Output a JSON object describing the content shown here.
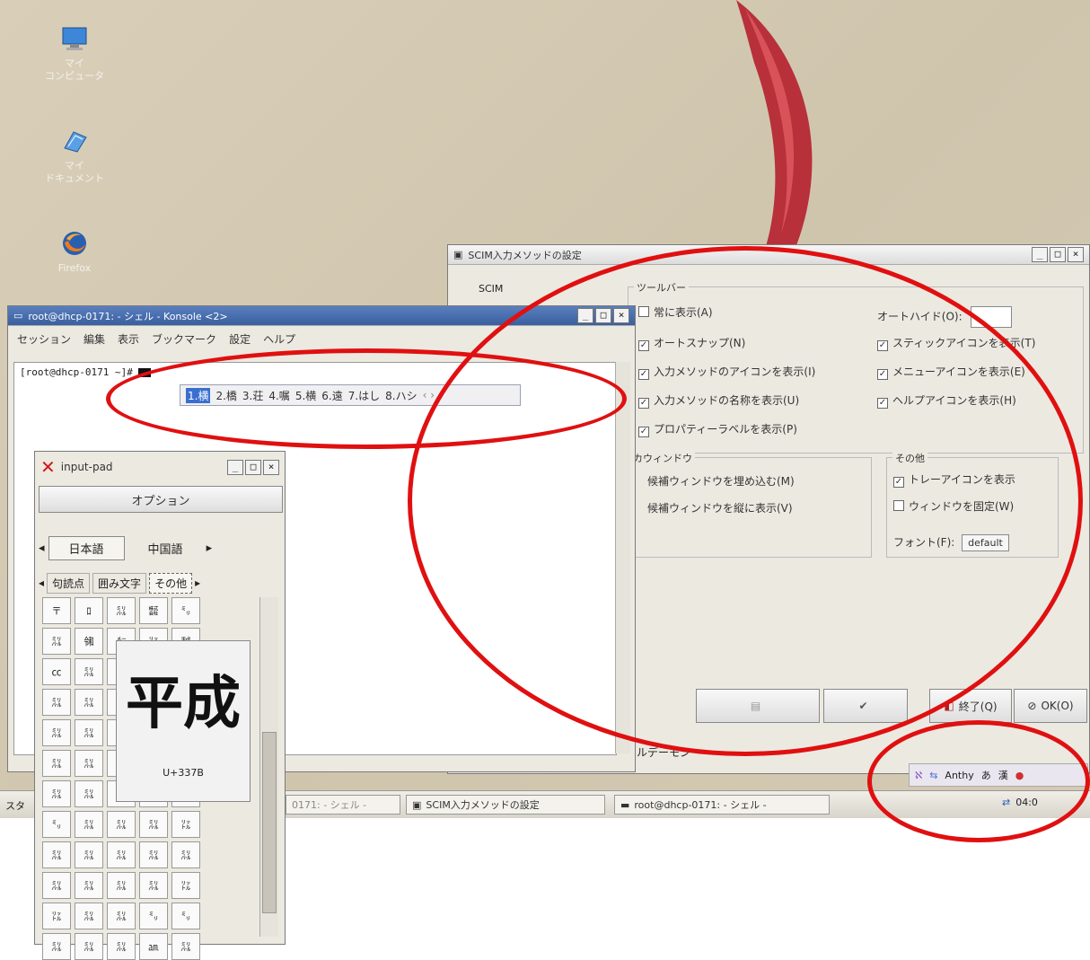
{
  "desktop": {
    "icons": [
      {
        "label_line1": "マイ",
        "label_line2": "コンピュータ",
        "icon": "monitor-icon"
      },
      {
        "label_line1": "マイ",
        "label_line2": "ドキュメント",
        "icon": "documents-icon"
      },
      {
        "label_line1": "Firefox",
        "label_line2": "",
        "icon": "firefox-icon"
      }
    ]
  },
  "scim": {
    "title": "SCIM入力メソッドの設定",
    "sidebar_item": "SCIM",
    "toolbar_group_title": "ツールバー",
    "options_left": [
      "常に表示(A)",
      "オートスナップ(N)",
      "入力メソッドのアイコンを表示(I)",
      "入力メソッドの名称を表示(U)",
      "プロパティーラベルを表示(P)"
    ],
    "auto_hide_label": "オートハイド(O):",
    "options_right": [
      "スティックアイコンを表示(T)",
      "メニューアイコンを表示(E)",
      "ヘルプアイコンを表示(H)"
    ],
    "candidate_group_title": "カウィンドウ",
    "candidate_options": [
      "候補ウィンドウを埋め込む(M)",
      "候補ウィンドウを縦に表示(V)"
    ],
    "other_group_title": "その他",
    "other_options": [
      {
        "label": "トレーアイコンを表示",
        "checked": "✓"
      },
      {
        "label": "ウィンドウを固定(W)",
        "checked": ""
      }
    ],
    "font_label": "フォント(F):",
    "font_value": "default",
    "buttons": {
      "apply": "",
      "reset": "",
      "exit": "終了(Q)",
      "ok": "OK(O)"
    },
    "footer_label": "ルデーモン"
  },
  "konsole": {
    "title": "root@dhcp-0171: - シェル - Konsole <2>",
    "menu": [
      "セッション",
      "編集",
      "表示",
      "ブックマーク",
      "設定",
      "ヘルプ"
    ],
    "prompt": "[root@dhcp-0171 ~]# ",
    "candidates": [
      "1.横",
      "2.橋",
      "3.荘",
      "4.嘱",
      "5.横",
      "6.遠",
      "7.はし",
      "8.ハシ"
    ]
  },
  "input_pad": {
    "title": "input-pad",
    "options_button": "オプション",
    "tabs_lang": [
      "日本語",
      "中国語"
    ],
    "tabs_sub": [
      "句読点",
      "囲み文字",
      "その他"
    ],
    "grid": [
      [
        "〒",
        "ﾛ",
        "㍊",
        "㍿",
        "㍉"
      ],
      [
        "㍊",
        "㋿",
        "㍍",
        "㍑",
        "㍻"
      ],
      [
        "㏄",
        "㍊",
        "",
        "",
        ""
      ],
      [
        "㍊",
        "㍊",
        "",
        "",
        ""
      ],
      [
        "㍊",
        "㍊",
        "",
        "",
        ""
      ],
      [
        "㍊",
        "㍊",
        "",
        "",
        ""
      ],
      [
        "㍊",
        "㍊",
        "",
        "",
        ""
      ],
      [
        "㍉",
        "㍊",
        "㍊",
        "㍊",
        "㍑"
      ],
      [
        "㍊",
        "㍊",
        "㍊",
        "㍊",
        "㍊"
      ],
      [
        "㍊",
        "㍊",
        "㍊",
        "㍊",
        "㍑"
      ],
      [
        "㍑",
        "㍊",
        "㍊",
        "㍉",
        "㍉"
      ],
      [
        "㍊",
        "㍊",
        "㍊",
        "㏂",
        "㍊"
      ]
    ],
    "preview_char": "平成",
    "preview_code": "U+337B"
  },
  "taskbar": {
    "start_label": "スタ",
    "tasks": [
      "0171: - シェル -",
      "SCIM入力メソッドの設定",
      "root@dhcp-0171: - シェル -"
    ],
    "tray_im": "Anthy",
    "tray_items": [
      "あ",
      "漢"
    ],
    "clock": "04:0"
  },
  "colors": {
    "annotation": "#e01010",
    "desktop": "#d4cab3",
    "ribbon": "#b8303a"
  }
}
